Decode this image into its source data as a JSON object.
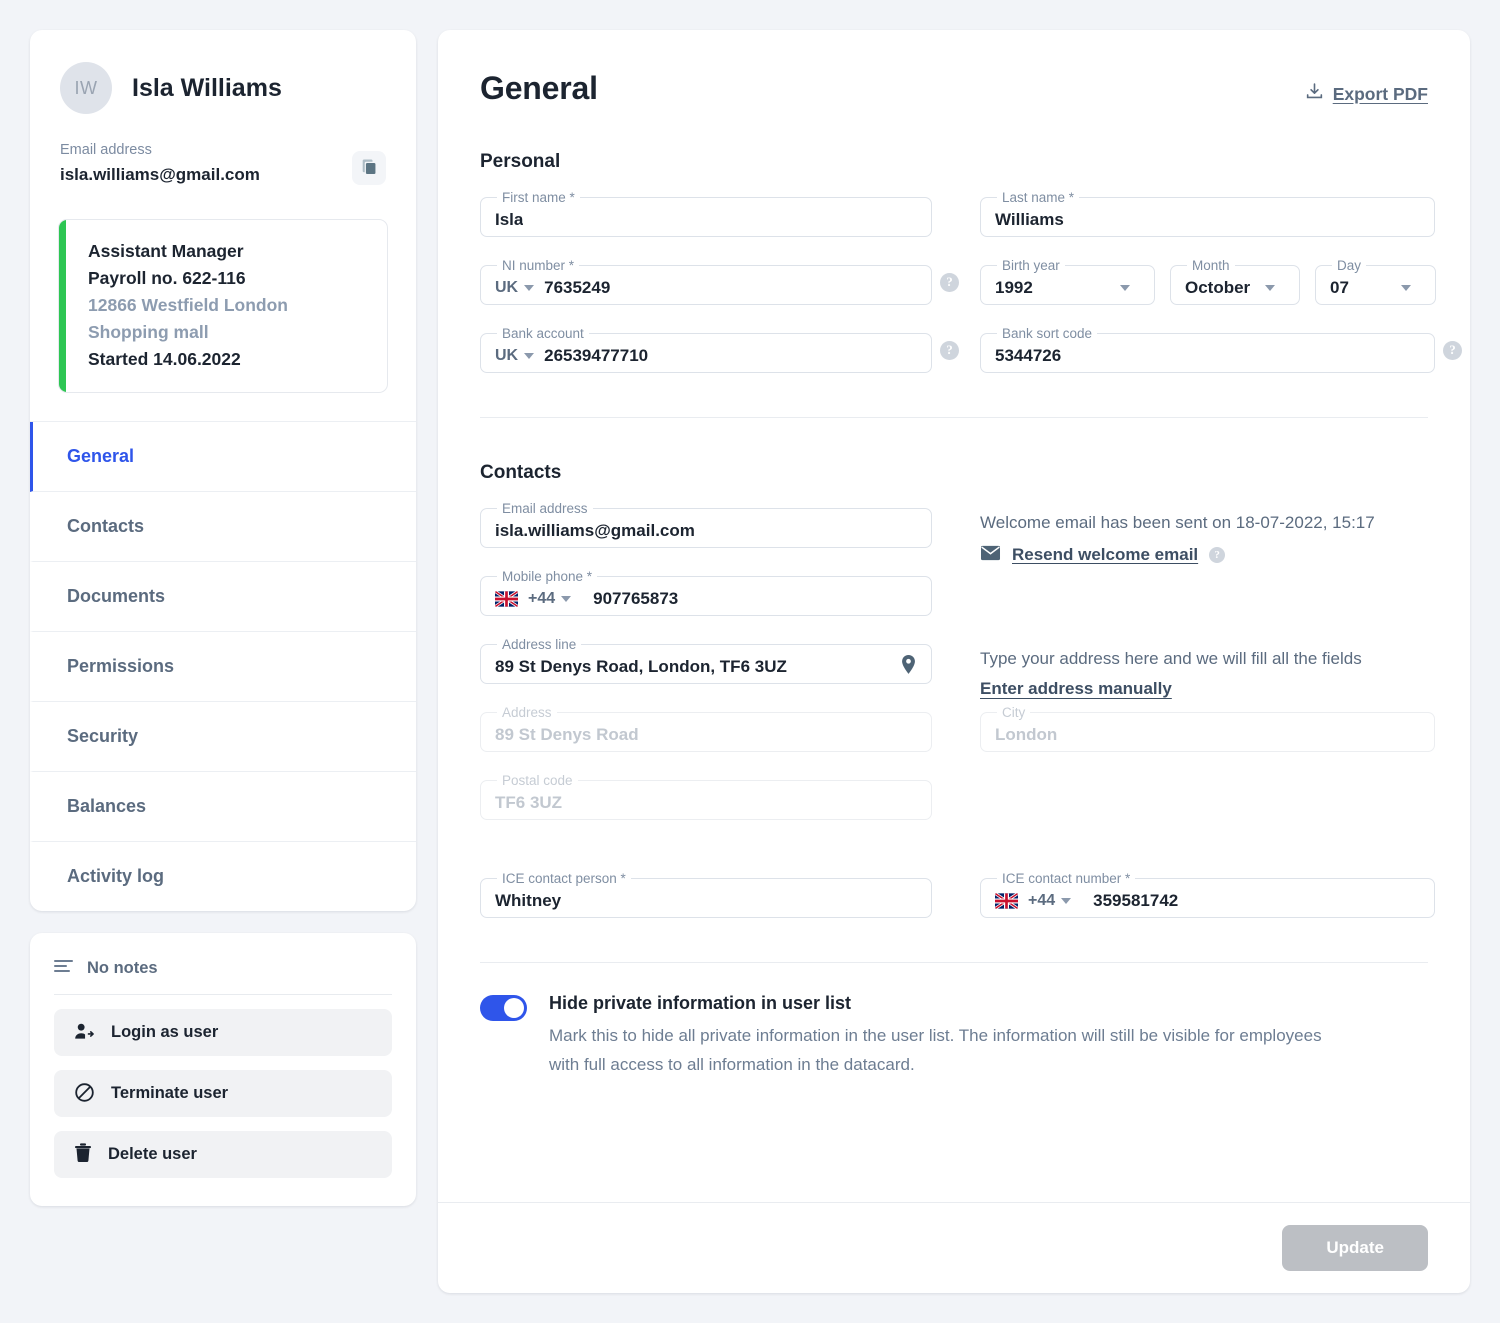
{
  "sidebar": {
    "avatar_initials": "IW",
    "user_name": "Isla Williams",
    "email_label": "Email address",
    "email_value": "isla.williams@gmail.com",
    "job": {
      "title": "Assistant Manager",
      "payroll": "Payroll no. 622-116",
      "location_line1": "12866 Westfield London",
      "location_line2": "Shopping mall",
      "started": "Started 14.06.2022"
    },
    "nav": [
      {
        "label": "General",
        "active": true
      },
      {
        "label": "Contacts",
        "active": false
      },
      {
        "label": "Documents",
        "active": false
      },
      {
        "label": "Permissions",
        "active": false
      },
      {
        "label": "Security",
        "active": false
      },
      {
        "label": "Balances",
        "active": false
      },
      {
        "label": "Activity log",
        "active": false
      }
    ],
    "notes_label": "No notes",
    "actions": [
      {
        "label": "Login as user",
        "icon": "user-add-icon"
      },
      {
        "label": "Terminate user",
        "icon": "ban-icon"
      },
      {
        "label": "Delete user",
        "icon": "trash-icon"
      }
    ]
  },
  "main": {
    "title": "General",
    "export_label": "Export PDF",
    "personal_title": "Personal",
    "contacts_title": "Contacts",
    "fields": {
      "first_name": {
        "label": "First name *",
        "value": "Isla"
      },
      "last_name": {
        "label": "Last name *",
        "value": "Williams"
      },
      "ni_number": {
        "label": "NI number *",
        "prefix": "UK",
        "value": "7635249"
      },
      "birth_year": {
        "label": "Birth year",
        "value": "1992"
      },
      "birth_month": {
        "label": "Month",
        "value": "October"
      },
      "birth_day": {
        "label": "Day",
        "value": "07"
      },
      "bank_account": {
        "label": "Bank account",
        "prefix": "UK",
        "value": "26539477710"
      },
      "bank_sort_code": {
        "label": "Bank sort code",
        "value": "5344726"
      },
      "email_address": {
        "label": "Email address",
        "value": "isla.williams@gmail.com"
      },
      "mobile_phone": {
        "label": "Mobile phone *",
        "dial_code": "+44",
        "value": "907765873"
      },
      "address_line": {
        "label": "Address line",
        "value": "89 St Denys Road, London, TF6 3UZ"
      },
      "address": {
        "label": "Address",
        "value": "89 St Denys Road"
      },
      "city": {
        "label": "City",
        "value": "London"
      },
      "postal_code": {
        "label": "Postal code",
        "value": "TF6 3UZ"
      },
      "ice_person": {
        "label": "ICE contact person *",
        "value": "Whitney"
      },
      "ice_number": {
        "label": "ICE contact number *",
        "dial_code": "+44",
        "value": "359581742"
      }
    },
    "welcome_email": {
      "status": "Welcome email has been sent on 18-07-2022, 15:17",
      "resend_label": "Resend welcome email"
    },
    "address_hint": {
      "text": "Type your address here and we will fill all the fields",
      "manual_label": "Enter address manually"
    },
    "privacy_toggle": {
      "enabled": true,
      "title": "Hide private information in user list",
      "description": "Mark this to hide all private information in the user list. The information will still be visible for employees with full access to all information in the datacard."
    },
    "update_label": "Update",
    "help_icon_glyph": "?"
  },
  "colors": {
    "accent": "#2f55ea",
    "status_green": "#2dc653",
    "muted_text": "#6d7d92"
  }
}
